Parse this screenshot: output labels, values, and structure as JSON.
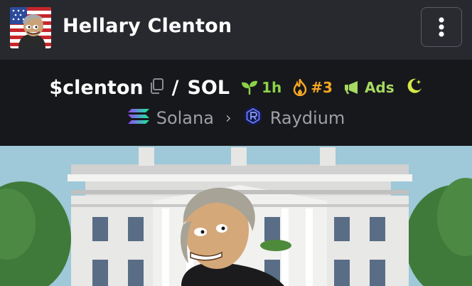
{
  "header": {
    "title": "Hellary Clenton",
    "avatar_icon": "meme-character-avatar",
    "menu_icon": "vertical-ellipsis-icon"
  },
  "token": {
    "base_symbol": "$clenton",
    "separator": "/",
    "quote_symbol": "SOL",
    "age_label": "1h",
    "rank_label": "#3",
    "ads_label": "Ads"
  },
  "chain": {
    "network": "Solana",
    "dex": "Raydium"
  },
  "colors": {
    "header_bg": "#28292e",
    "token_bg": "#17181b",
    "age_green": "#8bd14a",
    "rank_orange": "#f5a623",
    "ads_green": "#a6d962",
    "moon_yellow": "#d6e84a"
  },
  "banner": {
    "image": "white-house-with-meme-character"
  }
}
